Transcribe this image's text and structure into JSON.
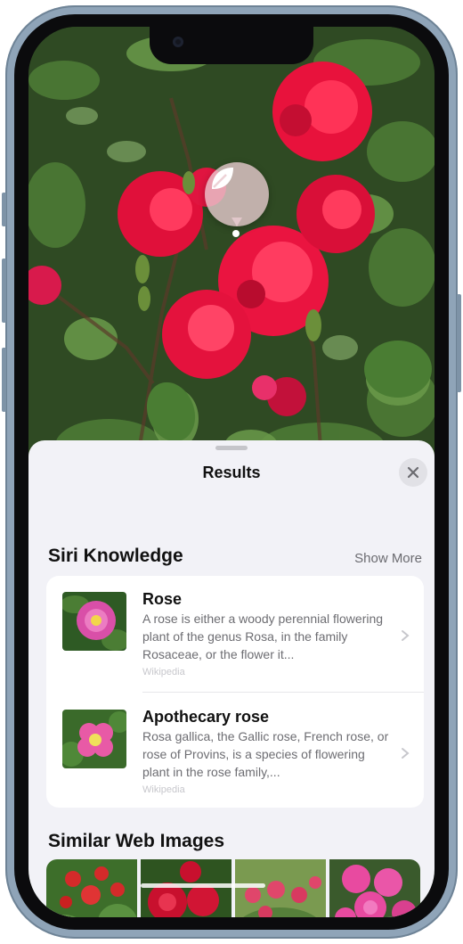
{
  "sheet": {
    "title": "Results",
    "close_icon": "xmark-icon"
  },
  "visual_lookup_icon": "leaf-icon",
  "siri_knowledge": {
    "title": "Siri Knowledge",
    "show_more": "Show More",
    "items": [
      {
        "title": "Rose",
        "description": "A rose is either a woody perennial flowering plant of the genus Rosa, in the family Rosaceae, or the flower it...",
        "source": "Wikipedia",
        "thumb_color": "#d94fa8"
      },
      {
        "title": "Apothecary rose",
        "description": "Rosa gallica, the Gallic rose, French rose, or rose of Provins, is a species of flowering plant in the rose family,...",
        "source": "Wikipedia",
        "thumb_color": "#e85aa6"
      }
    ]
  },
  "similar_web_images": {
    "title": "Similar Web Images",
    "images": [
      {
        "accent": "#d42a2a"
      },
      {
        "accent": "#c8102e"
      },
      {
        "accent": "#e0466b"
      },
      {
        "accent": "#e84aa0"
      }
    ]
  },
  "colors": {
    "rose_red": "#e8123c",
    "leaf_green": "#3e6b2c",
    "sheet_bg": "#f2f2f7"
  }
}
